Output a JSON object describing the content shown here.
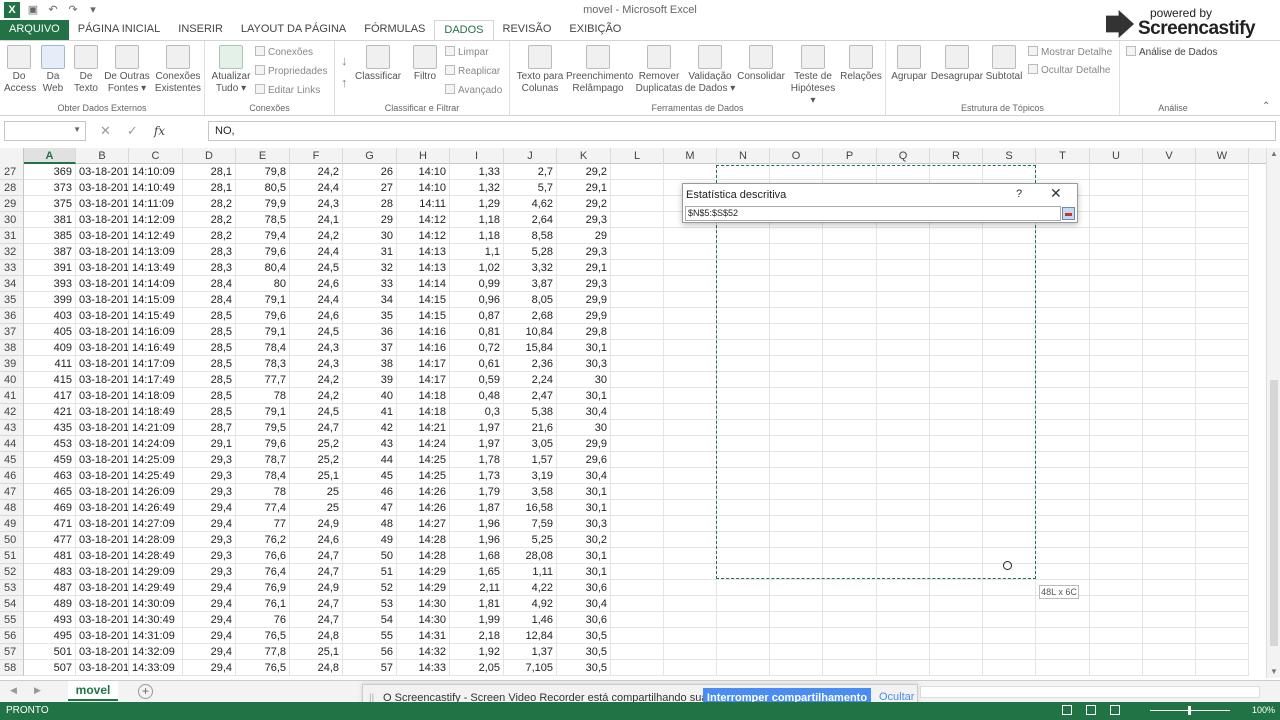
{
  "window": {
    "title": "movel - Microsoft Excel"
  },
  "qat": {
    "save_icon": "save-icon",
    "undo_icon": "undo-icon",
    "redo_icon": "redo-icon"
  },
  "tabs": [
    {
      "label": "ARQUIVO",
      "state": "file"
    },
    {
      "label": "PÁGINA INICIAL",
      "state": ""
    },
    {
      "label": "INSERIR",
      "state": ""
    },
    {
      "label": "LAYOUT DA PÁGINA",
      "state": ""
    },
    {
      "label": "FÓRMULAS",
      "state": ""
    },
    {
      "label": "DADOS",
      "state": "active"
    },
    {
      "label": "REVISÃO",
      "state": ""
    },
    {
      "label": "EXIBIÇÃO",
      "state": ""
    }
  ],
  "ribbon": {
    "groups": {
      "external": "Obter Dados Externos",
      "connections": "Conexões",
      "sort": "Classificar e Filtrar",
      "tools": "Ferramentas de Dados",
      "outline": "Estrutura de Tópicos",
      "analysis": "Análise"
    },
    "buttons": {
      "access": [
        "Do",
        "Access"
      ],
      "web": [
        "Da",
        "Web"
      ],
      "text": [
        "De",
        "Texto"
      ],
      "other": [
        "De Outras",
        "Fontes ▾"
      ],
      "existing": [
        "Conexões",
        "Existentes"
      ],
      "refresh": [
        "Atualizar",
        "Tudo ▾"
      ],
      "connections": "Conexões",
      "properties": "Propriedades",
      "edit_links": "Editar Links",
      "sort": "Classificar",
      "filter": "Filtro",
      "clear": "Limpar",
      "reapply": "Reaplicar",
      "advanced": "Avançado",
      "text_to_columns": [
        "Texto para",
        "Colunas"
      ],
      "flash_fill": [
        "Preenchimento",
        "Relâmpago"
      ],
      "remove_dup": [
        "Remover",
        "Duplicatas"
      ],
      "validation": [
        "Validação",
        "de Dados ▾"
      ],
      "consolidate": "Consolidar",
      "whatif": [
        "Teste de",
        "Hipóteses ▾"
      ],
      "relations": "Relações",
      "group": "Agrupar",
      "ungroup": "Desagrupar",
      "subtotal": "Subtotal",
      "show_detail": "Mostrar Detalhe",
      "hide_detail": "Ocultar Detalhe",
      "data_analysis": "Análise de Dados"
    }
  },
  "watermark": {
    "small": "powered by",
    "big": "Screencastify"
  },
  "formula_bar": {
    "name_box": "",
    "formula": "NO,"
  },
  "columns": [
    "A",
    "B",
    "C",
    "D",
    "E",
    "F",
    "G",
    "H",
    "I",
    "J",
    "K",
    "L",
    "M",
    "N",
    "O",
    "P",
    "Q",
    "R",
    "S",
    "T",
    "U",
    "V",
    "W"
  ],
  "rows": [
    {
      "n": "27",
      "c": [
        "369",
        "03-18-201",
        "14:10:09",
        "28,1",
        "79,8",
        "24,2",
        "26",
        "14:10",
        "1,33",
        "2,7",
        "29,2"
      ]
    },
    {
      "n": "28",
      "c": [
        "373",
        "03-18-201",
        "14:10:49",
        "28,1",
        "80,5",
        "24,4",
        "27",
        "14:10",
        "1,32",
        "5,7",
        "29,1"
      ]
    },
    {
      "n": "29",
      "c": [
        "375",
        "03-18-201",
        "14:11:09",
        "28,2",
        "79,9",
        "24,3",
        "28",
        "14:11",
        "1,29",
        "4,62",
        "29,2"
      ]
    },
    {
      "n": "30",
      "c": [
        "381",
        "03-18-201",
        "14:12:09",
        "28,2",
        "78,5",
        "24,1",
        "29",
        "14:12",
        "1,18",
        "2,64",
        "29,3"
      ]
    },
    {
      "n": "31",
      "c": [
        "385",
        "03-18-201",
        "14:12:49",
        "28,2",
        "79,4",
        "24,2",
        "30",
        "14:12",
        "1,18",
        "8,58",
        "29"
      ]
    },
    {
      "n": "32",
      "c": [
        "387",
        "03-18-201",
        "14:13:09",
        "28,3",
        "79,6",
        "24,4",
        "31",
        "14:13",
        "1,1",
        "5,28",
        "29,3"
      ]
    },
    {
      "n": "33",
      "c": [
        "391",
        "03-18-201",
        "14:13:49",
        "28,3",
        "80,4",
        "24,5",
        "32",
        "14:13",
        "1,02",
        "3,32",
        "29,1"
      ]
    },
    {
      "n": "34",
      "c": [
        "393",
        "03-18-201",
        "14:14:09",
        "28,4",
        "80",
        "24,6",
        "33",
        "14:14",
        "0,99",
        "3,87",
        "29,3"
      ]
    },
    {
      "n": "35",
      "c": [
        "399",
        "03-18-201",
        "14:15:09",
        "28,4",
        "79,1",
        "24,4",
        "34",
        "14:15",
        "0,96",
        "8,05",
        "29,9"
      ]
    },
    {
      "n": "36",
      "c": [
        "403",
        "03-18-201",
        "14:15:49",
        "28,5",
        "79,6",
        "24,6",
        "35",
        "14:15",
        "0,87",
        "2,68",
        "29,9"
      ]
    },
    {
      "n": "37",
      "c": [
        "405",
        "03-18-201",
        "14:16:09",
        "28,5",
        "79,1",
        "24,5",
        "36",
        "14:16",
        "0,81",
        "10,84",
        "29,8"
      ]
    },
    {
      "n": "38",
      "c": [
        "409",
        "03-18-201",
        "14:16:49",
        "28,5",
        "78,4",
        "24,3",
        "37",
        "14:16",
        "0,72",
        "15,84",
        "30,1"
      ]
    },
    {
      "n": "39",
      "c": [
        "411",
        "03-18-201",
        "14:17:09",
        "28,5",
        "78,3",
        "24,3",
        "38",
        "14:17",
        "0,61",
        "2,36",
        "30,3"
      ]
    },
    {
      "n": "40",
      "c": [
        "415",
        "03-18-201",
        "14:17:49",
        "28,5",
        "77,7",
        "24,2",
        "39",
        "14:17",
        "0,59",
        "2,24",
        "30"
      ]
    },
    {
      "n": "41",
      "c": [
        "417",
        "03-18-201",
        "14:18:09",
        "28,5",
        "78",
        "24,2",
        "40",
        "14:18",
        "0,48",
        "2,47",
        "30,1"
      ]
    },
    {
      "n": "42",
      "c": [
        "421",
        "03-18-201",
        "14:18:49",
        "28,5",
        "79,1",
        "24,5",
        "41",
        "14:18",
        "0,3",
        "5,38",
        "30,4"
      ]
    },
    {
      "n": "43",
      "c": [
        "435",
        "03-18-201",
        "14:21:09",
        "28,7",
        "79,5",
        "24,7",
        "42",
        "14:21",
        "1,97",
        "21,6",
        "30"
      ]
    },
    {
      "n": "44",
      "c": [
        "453",
        "03-18-201",
        "14:24:09",
        "29,1",
        "79,6",
        "25,2",
        "43",
        "14:24",
        "1,97",
        "3,05",
        "29,9"
      ]
    },
    {
      "n": "45",
      "c": [
        "459",
        "03-18-201",
        "14:25:09",
        "29,3",
        "78,7",
        "25,2",
        "44",
        "14:25",
        "1,78",
        "1,57",
        "29,6"
      ]
    },
    {
      "n": "46",
      "c": [
        "463",
        "03-18-201",
        "14:25:49",
        "29,3",
        "78,4",
        "25,1",
        "45",
        "14:25",
        "1,73",
        "3,19",
        "30,4"
      ]
    },
    {
      "n": "47",
      "c": [
        "465",
        "03-18-201",
        "14:26:09",
        "29,3",
        "78",
        "25",
        "46",
        "14:26",
        "1,79",
        "3,58",
        "30,1"
      ]
    },
    {
      "n": "48",
      "c": [
        "469",
        "03-18-201",
        "14:26:49",
        "29,4",
        "77,4",
        "25",
        "47",
        "14:26",
        "1,87",
        "16,58",
        "30,1"
      ]
    },
    {
      "n": "49",
      "c": [
        "471",
        "03-18-201",
        "14:27:09",
        "29,4",
        "77",
        "24,9",
        "48",
        "14:27",
        "1,96",
        "7,59",
        "30,3"
      ]
    },
    {
      "n": "50",
      "c": [
        "477",
        "03-18-201",
        "14:28:09",
        "29,3",
        "76,2",
        "24,6",
        "49",
        "14:28",
        "1,96",
        "5,25",
        "30,2"
      ]
    },
    {
      "n": "51",
      "c": [
        "481",
        "03-18-201",
        "14:28:49",
        "29,3",
        "76,6",
        "24,7",
        "50",
        "14:28",
        "1,68",
        "28,08",
        "30,1"
      ]
    },
    {
      "n": "52",
      "c": [
        "483",
        "03-18-201",
        "14:29:09",
        "29,3",
        "76,4",
        "24,7",
        "51",
        "14:29",
        "1,65",
        "1,11",
        "30,1"
      ]
    },
    {
      "n": "53",
      "c": [
        "487",
        "03-18-201",
        "14:29:49",
        "29,4",
        "76,9",
        "24,9",
        "52",
        "14:29",
        "2,11",
        "4,22",
        "30,6"
      ]
    },
    {
      "n": "54",
      "c": [
        "489",
        "03-18-201",
        "14:30:09",
        "29,4",
        "76,1",
        "24,7",
        "53",
        "14:30",
        "1,81",
        "4,92",
        "30,4"
      ]
    },
    {
      "n": "55",
      "c": [
        "493",
        "03-18-201",
        "14:30:49",
        "29,4",
        "76",
        "24,7",
        "54",
        "14:30",
        "1,99",
        "1,46",
        "30,6"
      ]
    },
    {
      "n": "56",
      "c": [
        "495",
        "03-18-201",
        "14:31:09",
        "29,4",
        "76,5",
        "24,8",
        "55",
        "14:31",
        "2,18",
        "12,84",
        "30,5"
      ]
    },
    {
      "n": "57",
      "c": [
        "501",
        "03-18-201",
        "14:32:09",
        "29,4",
        "77,8",
        "25,1",
        "56",
        "14:32",
        "1,92",
        "1,37",
        "30,5"
      ]
    },
    {
      "n": "58",
      "c": [
        "507",
        "03-18-201",
        "14:33:09",
        "29,4",
        "76,5",
        "24,8",
        "57",
        "14:33",
        "2,05",
        "7,105",
        "30,5"
      ]
    }
  ],
  "dialog": {
    "title": "Estatística descritiva",
    "help": "?",
    "close": "✕",
    "range_value": "$N$5:$S$52"
  },
  "size_hint": "48L x 6C",
  "sheet": {
    "name": "movel",
    "add": "+"
  },
  "share": {
    "message": "O Screencastify - Screen Video Recorder está compartilhando sua tela.",
    "stop": "Interromper compartilhamento",
    "hide": "Ocultar"
  },
  "status": {
    "ready": "PRONTO",
    "zoom": "100%"
  }
}
